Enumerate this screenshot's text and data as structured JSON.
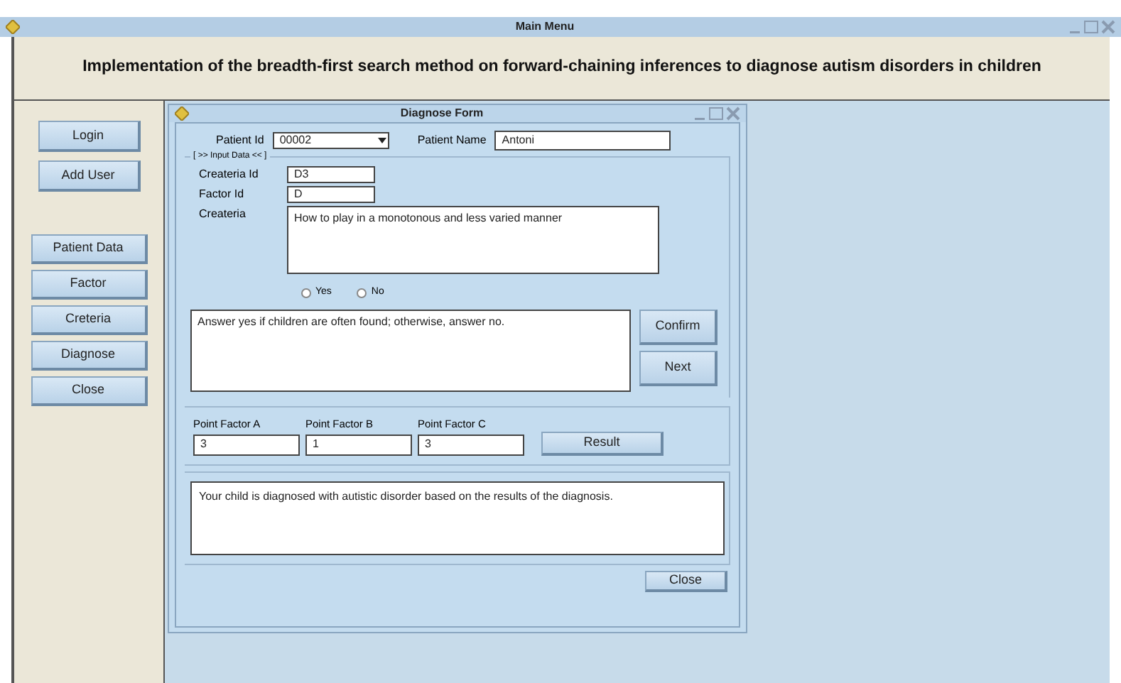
{
  "window": {
    "title": "Main Menu"
  },
  "header": "Implementation of the breadth-first search method on forward-chaining inferences to diagnose autism disorders in children",
  "sidebar": {
    "top_buttons": [
      "Login",
      "Add User"
    ],
    "menu_buttons": [
      "Patient Data",
      "Factor",
      "Creteria",
      "Diagnose",
      "Close"
    ]
  },
  "form": {
    "title": "Diagnose Form",
    "patient_id": {
      "label": "Patient Id",
      "value": "00002"
    },
    "patient_name": {
      "label": "Patient Name",
      "value": "Antoni"
    },
    "input_group": "[ >> Input Data << ]",
    "createria_id": {
      "label": "Createria Id",
      "value": "D3"
    },
    "factor_id": {
      "label": "Factor Id",
      "value": "D"
    },
    "createria": {
      "label": "Createria",
      "value": "How to play in a monotonous and less varied manner"
    },
    "answers": [
      {
        "label": "Yes",
        "selected": false
      },
      {
        "label": "No",
        "selected": false
      }
    ],
    "instruction": "Answer yes if children are often found; otherwise, answer no.",
    "side_buttons": [
      "Confirm",
      "Next"
    ],
    "points": [
      {
        "label": "Point Factor A",
        "value": "3"
      },
      {
        "label": "Point Factor B",
        "value": "1"
      },
      {
        "label": "Point Factor C",
        "value": "3"
      }
    ],
    "result_button": "Result",
    "result": "Your child is diagnosed with autistic disorder based on the results of the diagnosis.",
    "close_button": "Close"
  }
}
